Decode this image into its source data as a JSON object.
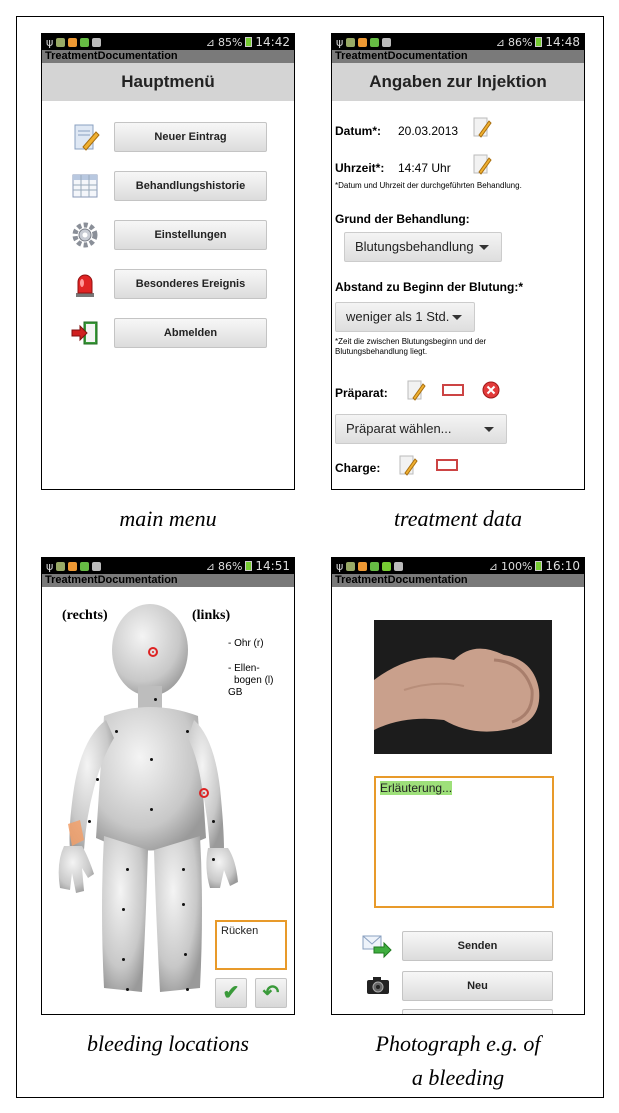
{
  "status": {
    "screen1": {
      "battery": "85%",
      "time": "14:42"
    },
    "screen2": {
      "battery": "86%",
      "time": "14:48"
    },
    "screen3": {
      "battery": "86%",
      "time": "14:51"
    },
    "screen4": {
      "battery": "100%",
      "time": "16:10"
    }
  },
  "app_name": "TreatmentDocumentation",
  "main_menu": {
    "title": "Hauptmenü",
    "items": [
      {
        "label": "Neuer Eintrag",
        "icon": "edit-document-icon"
      },
      {
        "label": "Behandlungshistorie",
        "icon": "table-icon"
      },
      {
        "label": "Einstellungen",
        "icon": "gear-icon"
      },
      {
        "label": "Besonderes Ereignis",
        "icon": "alarm-light-icon"
      },
      {
        "label": "Abmelden",
        "icon": "logout-door-icon"
      }
    ],
    "caption": "main menu"
  },
  "treatment": {
    "title": "Angaben zur Injektion",
    "date_label": "Datum*:",
    "date_value": "20.03.2013",
    "time_label": "Uhrzeit*:",
    "time_value": "14:47 Uhr",
    "datetime_note": "*Datum und Uhrzeit der durchgeführten Behandlung.",
    "reason_label": "Grund der Behandlung:",
    "reason_value": "Blutungsbehandlung",
    "interval_label": "Abstand zu Beginn der Blutung:*",
    "interval_value": "weniger als 1 Std.",
    "interval_note_1": "*Zeit die zwischen Blutungsbeginn und der",
    "interval_note_2": "Blutungsbehandlung liegt.",
    "preparation_label": "Präparat:",
    "preparation_value": "Präparat wählen...",
    "batch_label": "Charge:",
    "caption": "treatment data"
  },
  "bleeding": {
    "right_label": "(rechts)",
    "left_label": "(links)",
    "location_1": "- Ohr (r)",
    "location_2a": "- Ellen-",
    "location_2b": "bogen (l)",
    "location_2c": "GB",
    "input_value": "Rücken",
    "confirm_symbol": "✔",
    "back_symbol": "↶",
    "caption": "bleeding locations"
  },
  "photo": {
    "note_placeholder": "Erläuterung...",
    "send_label": "Senden",
    "new_label": "Neu",
    "caption_line1": "Photograph e.g. of",
    "caption_line2": "a bleeding"
  }
}
